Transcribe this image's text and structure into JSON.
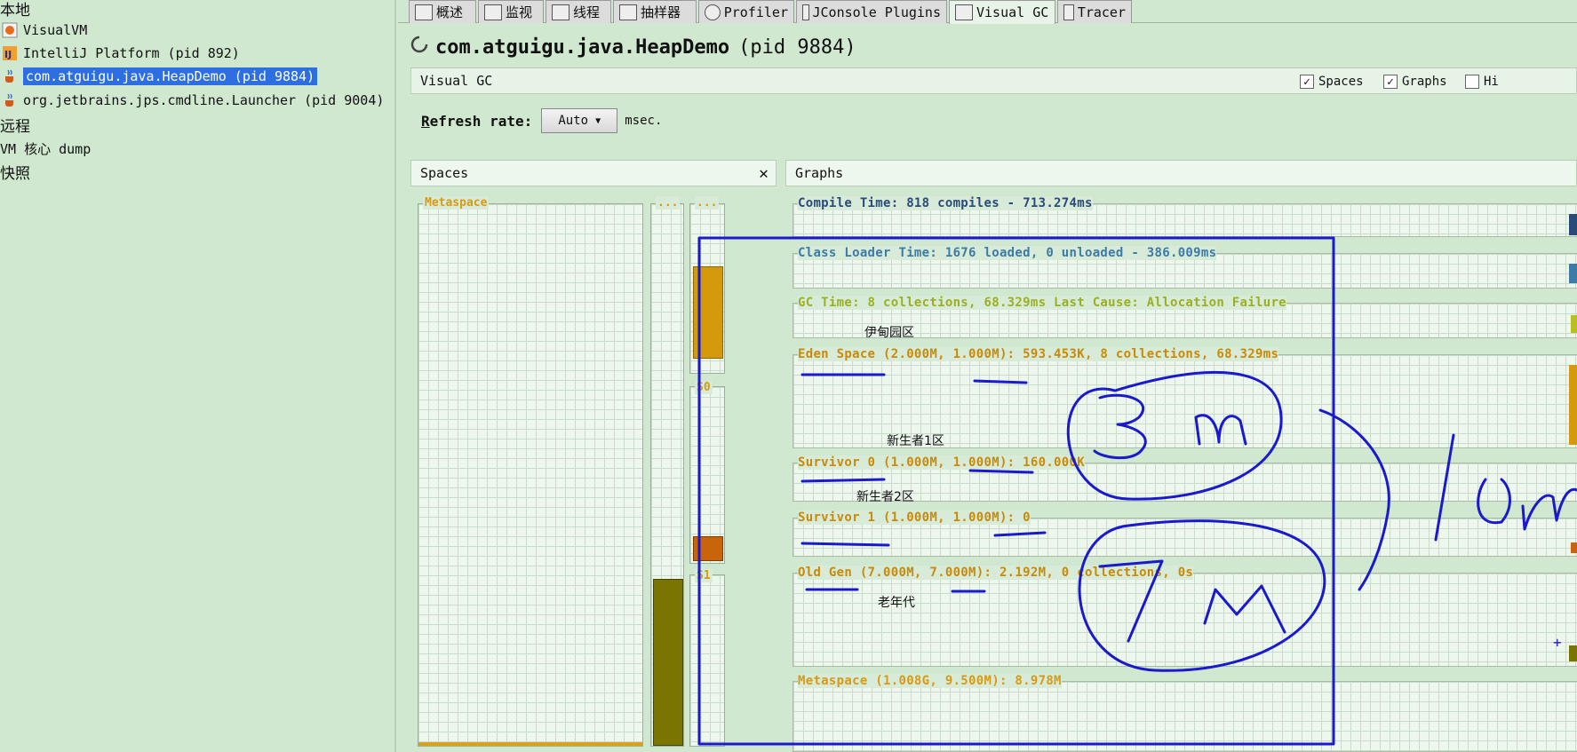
{
  "tree": {
    "local_label": "本地",
    "items": [
      {
        "label": "VisualVM"
      },
      {
        "label": "IntelliJ Platform (pid 892)"
      },
      {
        "label": "com.atguigu.java.HeapDemo (pid 9884)"
      },
      {
        "label": "org.jetbrains.jps.cmdline.Launcher (pid 9004)"
      }
    ],
    "remote_label": "远程",
    "coredump_label": "VM 核心 dump",
    "snapshot_label": "快照"
  },
  "tabs": [
    {
      "label": "概述"
    },
    {
      "label": "监视"
    },
    {
      "label": "线程"
    },
    {
      "label": "抽样器"
    },
    {
      "label": "Profiler"
    },
    {
      "label": "JConsole Plugins"
    },
    {
      "label": "Visual GC"
    },
    {
      "label": "Tracer"
    }
  ],
  "app": {
    "name": "com.atguigu.java.HeapDemo",
    "pid": "(pid 9884)"
  },
  "visual_gc_bar": {
    "title": "Visual GC",
    "spaces_label": "Spaces",
    "graphs_label": "Graphs",
    "hi_label": "Hi"
  },
  "refresh": {
    "label_first": "R",
    "label_rest": "efresh rate:",
    "value": "Auto",
    "unit": "msec."
  },
  "spaces_panel": {
    "title": "Spaces",
    "close": "✕",
    "metaspace_label": "Metaspace",
    "col1_label": "...",
    "col2_label": "...",
    "s0_label": "S0",
    "s1_label": "S1"
  },
  "graphs_panel": {
    "title": "Graphs",
    "compile_time": "Compile Time: 818 compiles - 713.274ms",
    "class_loader": "Class Loader Time: 1676 loaded, 0 unloaded - 386.009ms",
    "gc_time": "GC Time: 8 collections, 68.329ms Last Cause: Allocation Failure",
    "eden": "Eden Space (2.000M, 1.000M): 593.453K, 8 collections, 68.329ms",
    "survivor0": "Survivor 0 (1.000M, 1.000M): 160.000K",
    "survivor1": "Survivor 1 (1.000M, 1.000M): 0",
    "old_gen": "Old Gen (7.000M, 7.000M): 2.192M, 0 collections, 0s",
    "metaspace": "Metaspace (1.008G, 9.500M): 8.978M"
  },
  "annotations": {
    "eden_cn": "伊甸园区",
    "survivor0_cn": "新生者1区",
    "survivor1_cn": "新生者2区",
    "oldgen_cn": "老年代",
    "ink_color": "#1a1acc"
  },
  "colors": {
    "selection": "#2d6fe0",
    "gold": "#d89a14",
    "olive": "#7a7400",
    "rust": "#c8640a"
  }
}
